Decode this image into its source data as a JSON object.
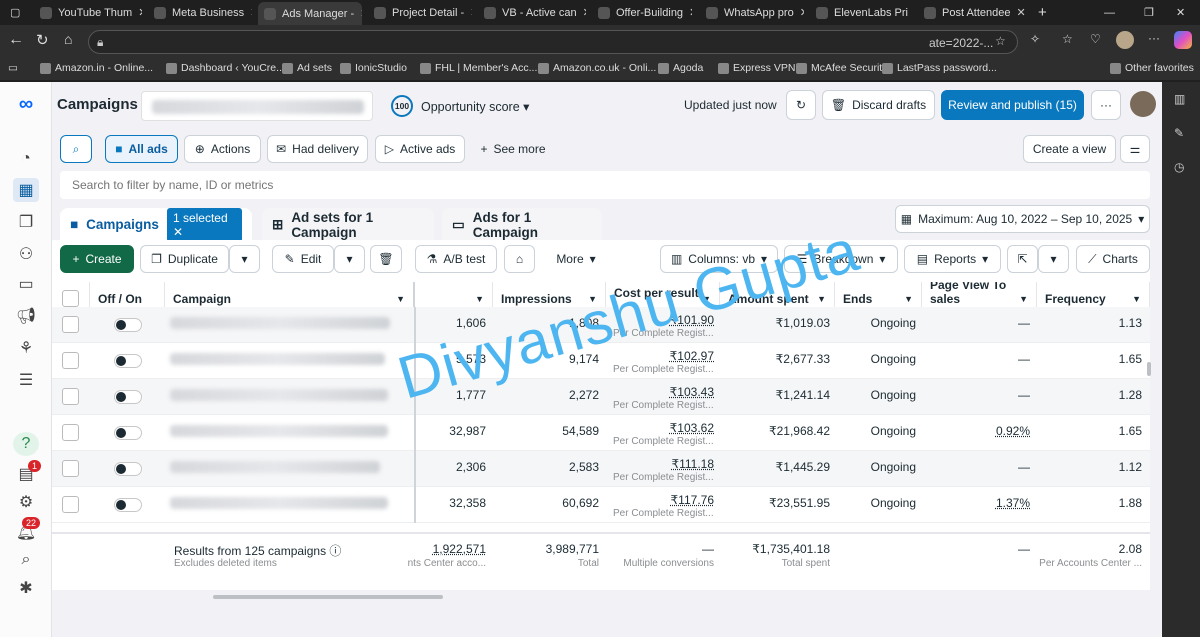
{
  "browser": {
    "tabs": [
      {
        "label": "YouTube Thum"
      },
      {
        "label": "Meta Business"
      },
      {
        "label": "Ads Manager -",
        "active": true
      },
      {
        "label": "Project Detail -"
      },
      {
        "label": "VB - Active can"
      },
      {
        "label": "Offer-Building"
      },
      {
        "label": "WhatsApp pro"
      },
      {
        "label": "ElevenLabs Pri"
      },
      {
        "label": "Post Attendee"
      }
    ],
    "url_tail": "ate=2022-...",
    "bookmarks": [
      "Amazon.in - Online...",
      "Dashboard ‹ YouCre...",
      "Ad sets",
      "IonicStudio",
      "FHL | Member's Acc...",
      "Amazon.co.uk - Onli...",
      "Agoda",
      "Express VPN",
      "McAfee Security",
      "LastPass password...",
      "Other favorites"
    ]
  },
  "header": {
    "title": "Campaigns",
    "score": "100",
    "opportunity": "Opportunity score",
    "updated": "Updated just now",
    "discard": "Discard drafts",
    "publish": "Review and publish (15)",
    "more": "···"
  },
  "filters": {
    "all_ads": "All ads",
    "actions": "Actions",
    "had_delivery": "Had delivery",
    "active_ads": "Active ads",
    "see_more": "See more",
    "create_view": "Create a view",
    "search_placeholder": "Search to filter by name, ID or metrics"
  },
  "level_tabs": {
    "campaigns": "Campaigns",
    "selected": "1 selected",
    "adsets": "Ad sets for 1 Campaign",
    "ads": "Ads for 1 Campaign",
    "date": "Maximum: Aug 10, 2022 – Sep 10, 2025"
  },
  "toolbar": {
    "create": "Create",
    "duplicate": "Duplicate",
    "edit": "Edit",
    "ab": "A/B test",
    "more": "More",
    "columns": "Columns: vb",
    "breakdown": "Breakdown",
    "reports": "Reports",
    "charts": "Charts"
  },
  "table": {
    "headers": {
      "offon": "Off / On",
      "campaign": "Campaign",
      "impressions": "Impressions",
      "cpr": "Cost per result",
      "spent": "Amount spent",
      "ends": "Ends",
      "pv": "Page View To sales Conversi...",
      "freq": "Frequency"
    },
    "rows": [
      {
        "results": "1,606",
        "impressions": "1,808",
        "cpr": "₹101.90",
        "cpr_sub": "Per Complete Regist...",
        "spent": "₹1,019.03",
        "ends": "Ongoing",
        "pv": "—",
        "freq": "1.13"
      },
      {
        "results": "5,573",
        "impressions": "9,174",
        "cpr": "₹102.97",
        "cpr_sub": "Per Complete Regist...",
        "spent": "₹2,677.33",
        "ends": "Ongoing",
        "pv": "—",
        "freq": "1.65"
      },
      {
        "results": "1,777",
        "impressions": "2,272",
        "cpr": "₹103.43",
        "cpr_sub": "Per Complete Regist...",
        "spent": "₹1,241.14",
        "ends": "Ongoing",
        "pv": "—",
        "freq": "1.28"
      },
      {
        "results": "32,987",
        "impressions": "54,589",
        "cpr": "₹103.62",
        "cpr_sub": "Per Complete Regist...",
        "spent": "₹21,968.42",
        "ends": "Ongoing",
        "pv": "0.92%",
        "freq": "1.65"
      },
      {
        "results": "2,306",
        "impressions": "2,583",
        "cpr": "₹111.18",
        "cpr_sub": "Per Complete Regist...",
        "spent": "₹1,445.29",
        "ends": "Ongoing",
        "pv": "—",
        "freq": "1.12"
      },
      {
        "results": "32,358",
        "impressions": "60,692",
        "cpr": "₹117.76",
        "cpr_sub": "Per Complete Regist...",
        "spent": "₹23,551.95",
        "ends": "Ongoing",
        "pv": "1.37%",
        "freq": "1.88"
      }
    ],
    "footer": {
      "label": "Results from 125 campaigns",
      "sub": "Excludes deleted items",
      "results": "1,922,571",
      "results_sub": "nts Center acco...",
      "impressions": "3,989,771",
      "impressions_sub": "Total",
      "cpr": "—",
      "cpr_sub": "Multiple conversions",
      "spent": "₹1,735,401.18",
      "spent_sub": "Total spent",
      "pv": "—",
      "freq": "2.08",
      "freq_sub": "Per Accounts Center ..."
    }
  },
  "badges": {
    "notif1": "1",
    "notif2": "22"
  },
  "watermark": "Divyanshu Gupta"
}
